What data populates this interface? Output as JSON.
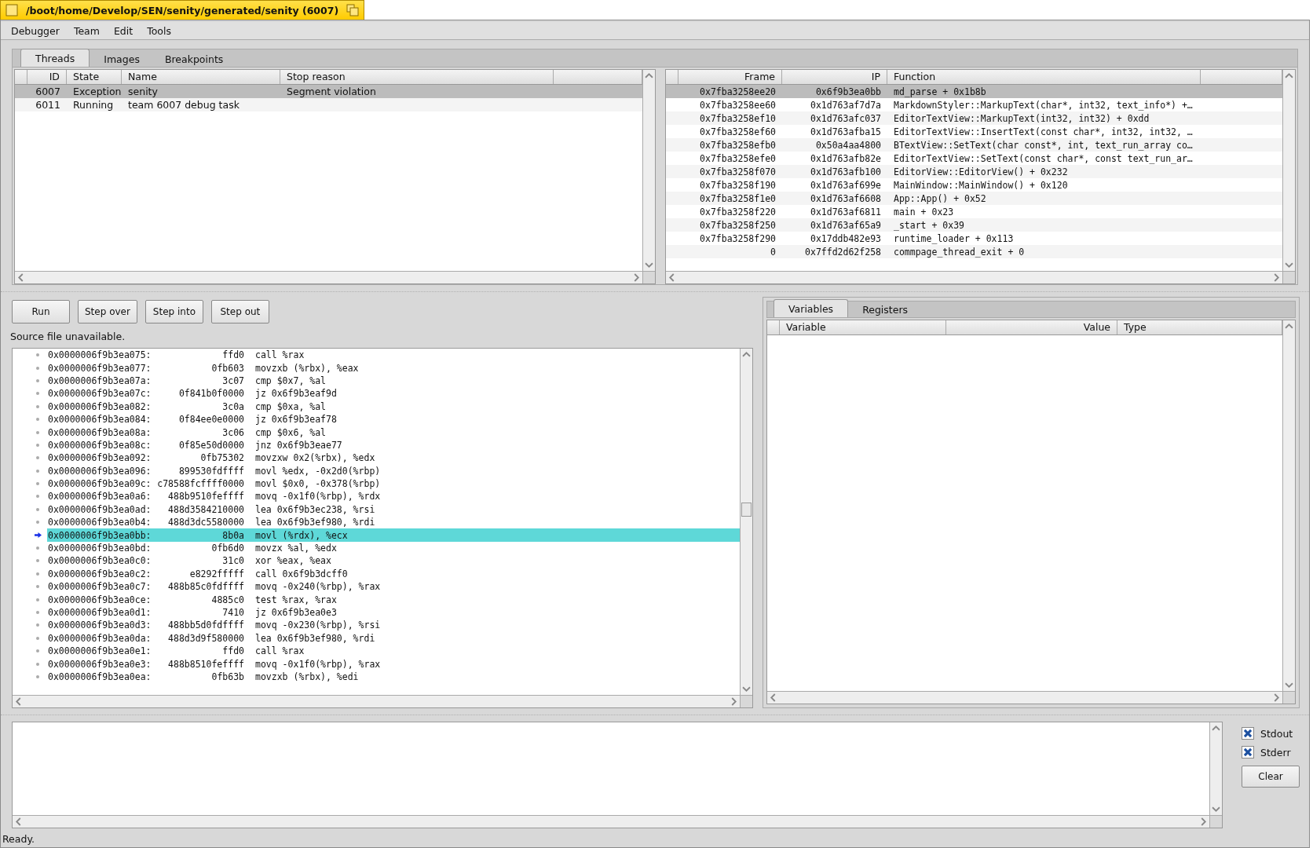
{
  "window": {
    "title": "/boot/home/Develop/SEN/senity/generated/senity (6007)"
  },
  "menu": [
    "Debugger",
    "Team",
    "Edit",
    "Tools"
  ],
  "tabs": [
    {
      "label": "Threads",
      "selected": true
    },
    {
      "label": "Images",
      "selected": false
    },
    {
      "label": "Breakpoints",
      "selected": false
    }
  ],
  "threads": {
    "columns": [
      "ID",
      "State",
      "Name",
      "Stop reason"
    ],
    "rows": [
      {
        "id": "6007",
        "state": "Exception",
        "name": "senity",
        "stop_reason": "Segment violation",
        "selected": true
      },
      {
        "id": "6011",
        "state": "Running",
        "name": "team 6007 debug task",
        "selected": false
      }
    ]
  },
  "stack": {
    "columns": [
      "Frame",
      "IP",
      "Function"
    ],
    "rows": [
      {
        "frame": "0x7fba3258ee20",
        "ip": "0x6f9b3ea0bb",
        "function": "md_parse + 0x1b8b",
        "selected": true
      },
      {
        "frame": "0x7fba3258ee60",
        "ip": "0x1d763af7d7a",
        "function": "MarkdownStyler::MarkupText(char*, int32, text_info*) +…",
        "selected": false
      },
      {
        "frame": "0x7fba3258ef10",
        "ip": "0x1d763afc037",
        "function": "EditorTextView::MarkupText(int32, int32) + 0xdd",
        "selected": false
      },
      {
        "frame": "0x7fba3258ef60",
        "ip": "0x1d763afba15",
        "function": "EditorTextView::InsertText(const char*, int32, int32, …",
        "selected": false
      },
      {
        "frame": "0x7fba3258efb0",
        "ip": "0x50a4aa4800",
        "function": "BTextView::SetText(char const*, int, text_run_array co…",
        "selected": false
      },
      {
        "frame": "0x7fba3258efe0",
        "ip": "0x1d763afb82e",
        "function": "EditorTextView::SetText(const char*, const text_run_ar…",
        "selected": false
      },
      {
        "frame": "0x7fba3258f070",
        "ip": "0x1d763afb100",
        "function": "EditorView::EditorView() + 0x232",
        "selected": false
      },
      {
        "frame": "0x7fba3258f190",
        "ip": "0x1d763af699e",
        "function": "MainWindow::MainWindow() + 0x120",
        "selected": false
      },
      {
        "frame": "0x7fba3258f1e0",
        "ip": "0x1d763af6608",
        "function": "App::App() + 0x52",
        "selected": false
      },
      {
        "frame": "0x7fba3258f220",
        "ip": "0x1d763af6811",
        "function": "main + 0x23",
        "selected": false
      },
      {
        "frame": "0x7fba3258f250",
        "ip": "0x1d763af65a9",
        "function": "_start + 0x39",
        "selected": false
      },
      {
        "frame": "0x7fba3258f290",
        "ip": "0x17ddb482e93",
        "function": "runtime_loader + 0x113",
        "selected": false
      },
      {
        "frame": "0",
        "ip": "0x7ffd2d62f258",
        "function": "commpage_thread_exit + 0",
        "selected": false
      }
    ]
  },
  "buttons": [
    "Run",
    "Step over",
    "Step into",
    "Step out"
  ],
  "source_message": "Source file unavailable.",
  "disassembly": [
    {
      "address": "0x0000006f9b3ea075:",
      "bytes": "ffd0",
      "instruction": "call %rax",
      "current": false
    },
    {
      "address": "0x0000006f9b3ea077:",
      "bytes": "0fb603",
      "instruction": "movzxb (%rbx), %eax",
      "current": false
    },
    {
      "address": "0x0000006f9b3ea07a:",
      "bytes": "3c07",
      "instruction": "cmp $0x7, %al",
      "current": false
    },
    {
      "address": "0x0000006f9b3ea07c:",
      "bytes": "0f841b0f0000",
      "instruction": "jz 0x6f9b3eaf9d",
      "current": false
    },
    {
      "address": "0x0000006f9b3ea082:",
      "bytes": "3c0a",
      "instruction": "cmp $0xa, %al",
      "current": false
    },
    {
      "address": "0x0000006f9b3ea084:",
      "bytes": "0f84ee0e0000",
      "instruction": "jz 0x6f9b3eaf78",
      "current": false
    },
    {
      "address": "0x0000006f9b3ea08a:",
      "bytes": "3c06",
      "instruction": "cmp $0x6, %al",
      "current": false
    },
    {
      "address": "0x0000006f9b3ea08c:",
      "bytes": "0f85e50d0000",
      "instruction": "jnz 0x6f9b3eae77",
      "current": false
    },
    {
      "address": "0x0000006f9b3ea092:",
      "bytes": "0fb75302",
      "instruction": "movzxw 0x2(%rbx), %edx",
      "current": false
    },
    {
      "address": "0x0000006f9b3ea096:",
      "bytes": "899530fdffff",
      "instruction": "movl %edx, -0x2d0(%rbp)",
      "current": false
    },
    {
      "address": "0x0000006f9b3ea09c:",
      "bytes": "c78588fcffff0000",
      "instruction": "movl $0x0, -0x378(%rbp)",
      "current": false
    },
    {
      "address": "0x0000006f9b3ea0a6:",
      "bytes": "488b9510feffff",
      "instruction": "movq -0x1f0(%rbp), %rdx",
      "current": false
    },
    {
      "address": "0x0000006f9b3ea0ad:",
      "bytes": "488d3584210000",
      "instruction": "lea 0x6f9b3ec238, %rsi",
      "current": false
    },
    {
      "address": "0x0000006f9b3ea0b4:",
      "bytes": "488d3dc5580000",
      "instruction": "lea 0x6f9b3ef980, %rdi",
      "current": false
    },
    {
      "address": "0x0000006f9b3ea0bb:",
      "bytes": "8b0a",
      "instruction": "movl (%rdx), %ecx",
      "current": true
    },
    {
      "address": "0x0000006f9b3ea0bd:",
      "bytes": "0fb6d0",
      "instruction": "movzx %al, %edx",
      "current": false
    },
    {
      "address": "0x0000006f9b3ea0c0:",
      "bytes": "31c0",
      "instruction": "xor %eax, %eax",
      "current": false
    },
    {
      "address": "0x0000006f9b3ea0c2:",
      "bytes": "e8292fffff",
      "instruction": "call 0x6f9b3dcff0",
      "current": false
    },
    {
      "address": "0x0000006f9b3ea0c7:",
      "bytes": "488b85c0fdffff",
      "instruction": "movq -0x240(%rbp), %rax",
      "current": false
    },
    {
      "address": "0x0000006f9b3ea0ce:",
      "bytes": "4885c0",
      "instruction": "test %rax, %rax",
      "current": false
    },
    {
      "address": "0x0000006f9b3ea0d1:",
      "bytes": "7410",
      "instruction": "jz 0x6f9b3ea0e3",
      "current": false
    },
    {
      "address": "0x0000006f9b3ea0d3:",
      "bytes": "488bb5d0fdffff",
      "instruction": "movq -0x230(%rbp), %rsi",
      "current": false
    },
    {
      "address": "0x0000006f9b3ea0da:",
      "bytes": "488d3d9f580000",
      "instruction": "lea 0x6f9b3ef980, %rdi",
      "current": false
    },
    {
      "address": "0x0000006f9b3ea0e1:",
      "bytes": "ffd0",
      "instruction": "call %rax",
      "current": false
    },
    {
      "address": "0x0000006f9b3ea0e3:",
      "bytes": "488b8510feffff",
      "instruction": "movq -0x1f0(%rbp), %rax",
      "current": false
    },
    {
      "address": "0x0000006f9b3ea0ea:",
      "bytes": "0fb63b",
      "instruction": "movzxb (%rbx), %edi",
      "current": false
    }
  ],
  "variable_tabs": [
    {
      "label": "Variables",
      "selected": true
    },
    {
      "label": "Registers",
      "selected": false
    }
  ],
  "variables": {
    "columns": [
      "Variable",
      "Value",
      "Type"
    ]
  },
  "console": {
    "options": [
      {
        "label": "Stdout",
        "checked": true
      },
      {
        "label": "Stderr",
        "checked": true
      }
    ],
    "clear_button": "Clear"
  },
  "status_bar": "Ready."
}
